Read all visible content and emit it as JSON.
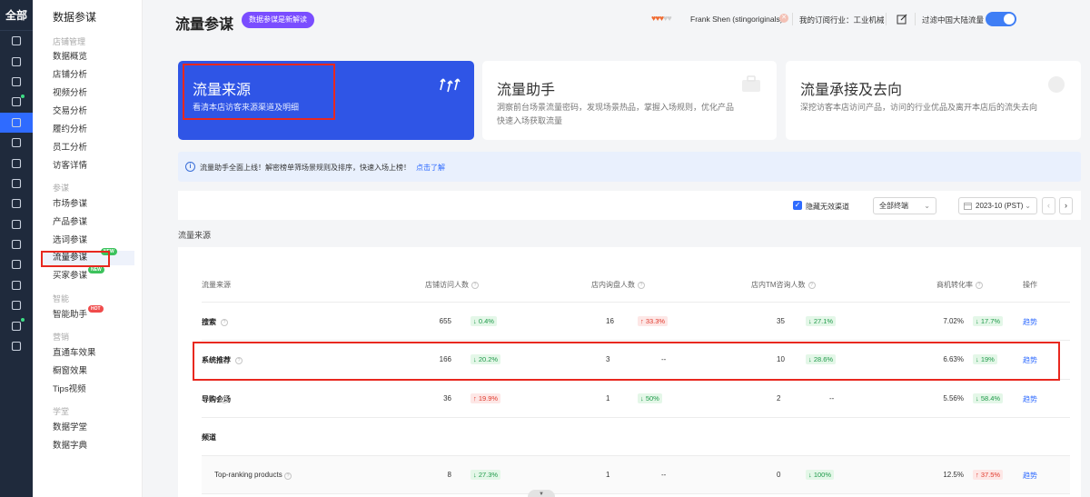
{
  "rail": {
    "top_label": "全部",
    "icons": [
      "home-icon",
      "store-icon",
      "archive-icon",
      "video-icon",
      "chart-icon",
      "broadcast-icon",
      "ticket-icon",
      "message-icon",
      "users-icon",
      "clipboard-icon",
      "globe-icon",
      "bag-icon",
      "truck-icon",
      "shield-icon",
      "plant-icon",
      "briefcase-icon"
    ]
  },
  "sidebar": {
    "title": "数据参谋",
    "groups": {
      "shop": "店铺管理",
      "canmou": "参谋",
      "smart": "智能",
      "marketing": "营销",
      "study": "学堂"
    },
    "items": {
      "overview": "数据概览",
      "shop_analysis": "店铺分析",
      "video_analysis": "视频分析",
      "trade_analysis": "交易分析",
      "fulfill_analysis": "履约分析",
      "staff_analysis": "员工分析",
      "visitor_detail": "访客详情",
      "market": "市场参谋",
      "product": "产品参谋",
      "keyword": "选词参谋",
      "traffic": "流量参谋",
      "buyer": "买家参谋",
      "assistant": "智能助手",
      "p4p": "直通车效果",
      "showcase": "橱窗效果",
      "tips_video": "Tips视频",
      "study_hall": "数据学堂",
      "dictionary": "数据字典"
    },
    "badges": {
      "new": "NEW",
      "hot": "HOT"
    }
  },
  "header": {
    "title": "流量参谋",
    "pill": "数据参谋是新解读",
    "user": "Frank Shen (stingoriginals)",
    "industry": "我的订阅行业：工业机械",
    "filter_label": "过滤中国大陆流量"
  },
  "cards": [
    {
      "title": "流量来源",
      "desc": "看清本店访客来源渠道及明细"
    },
    {
      "title": "流量助手",
      "desc": "洞察前台场景流量密码，发现场景热品，掌握入场规则，优化产品",
      "desc2": "快速入场获取流量"
    },
    {
      "title": "流量承接及去向",
      "desc": "深挖访客本店访问产品，访问的行业优品及离开本店后的流失去向"
    }
  ],
  "notice": {
    "text": "流量助手全面上线！解密榜单筛场景规则及排序，快速入场上榜！",
    "link": "点击了解"
  },
  "filters": {
    "hide_invalid": "隐藏无效渠道",
    "terminal": "全部终端",
    "date": "2023-10 (PST)",
    "prev": "‹",
    "next": "›"
  },
  "section_label": "流量来源",
  "table": {
    "headers": {
      "source": "流量来源",
      "visitors": "店铺访问人数",
      "inquirers": "店内询盘人数",
      "tm": "店内TM咨询人数",
      "conversion": "商机转化率",
      "action": "操作"
    },
    "rows": [
      {
        "name": "搜索",
        "visitors": "655",
        "visitors_chg": "↓ 0.4%",
        "visitors_dir": "down",
        "inquirers": "16",
        "inquirers_chg": "↑ 33.3%",
        "inquirers_dir": "up",
        "tm": "35",
        "tm_chg": "↓ 27.1%",
        "tm_dir": "down",
        "conversion": "7.02%",
        "conversion_chg": "↓ 17.7%",
        "conversion_dir": "down",
        "action": "趋势"
      },
      {
        "name": "系统推荐",
        "visitors": "166",
        "visitors_chg": "↓ 20.2%",
        "visitors_dir": "down",
        "inquirers": "3",
        "inquirers_chg": "--",
        "inquirers_dir": "none",
        "tm": "10",
        "tm_chg": "↓ 28.6%",
        "tm_dir": "down",
        "conversion": "6.63%",
        "conversion_chg": "↓ 19%",
        "conversion_dir": "down",
        "action": "趋势"
      },
      {
        "name": "导购会场",
        "visitors": "36",
        "visitors_chg": "↑ 19.9%",
        "visitors_dir": "up",
        "inquirers": "1",
        "inquirers_chg": "↓ 50%",
        "inquirers_dir": "down",
        "tm": "2",
        "tm_chg": "--",
        "tm_dir": "none",
        "conversion": "5.56%",
        "conversion_chg": "↓ 58.4%",
        "conversion_dir": "down",
        "action": "趋势"
      },
      {
        "name": "频道"
      },
      {
        "name": "Top-ranking products",
        "visitors": "8",
        "visitors_chg": "↓ 27.3%",
        "visitors_dir": "down",
        "inquirers": "1",
        "inquirers_chg": "--",
        "inquirers_dir": "none",
        "tm": "0",
        "tm_chg": "↓ 100%",
        "tm_dir": "down",
        "conversion": "12.5%",
        "conversion_chg": "↑ 37.5%",
        "conversion_dir": "up",
        "action": "趋势"
      }
    ]
  },
  "colors": {
    "accent": "#2f55e6",
    "pill": "#7a4dff",
    "highlight": "#e8281f",
    "down": "#1f9a4a",
    "up": "#e0392c"
  }
}
